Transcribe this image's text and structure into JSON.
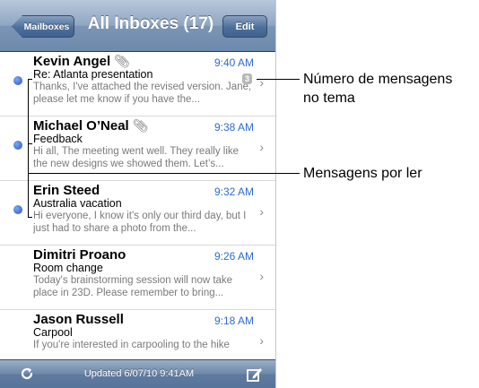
{
  "navbar": {
    "back_label": "Mailboxes",
    "title": "All Inboxes (17)",
    "edit_label": "Edit"
  },
  "messages": [
    {
      "sender": "Kevin Angel",
      "attachment": true,
      "time": "9:40 AM",
      "subject": "Re: Atlanta presentation",
      "preview": "Thanks, I've attached the revised version. Jane, please let me know if you have the...",
      "count": "3",
      "unread": true
    },
    {
      "sender": "Michael O’Neal",
      "attachment": true,
      "time": "9:38 AM",
      "subject": "Feedback",
      "preview": "Hi all, The meeting went well. They really like the new designs we showed them. Let’s...",
      "unread": true
    },
    {
      "sender": "Erin Steed",
      "attachment": false,
      "time": "9:32 AM",
      "subject": "Australia vacation",
      "preview": "Hi everyone, I know it’s only our third day, but I just had to share a photo from the...",
      "unread": true
    },
    {
      "sender": "Dimitri Proano",
      "attachment": false,
      "time": "9:26 AM",
      "subject": "Room change",
      "preview": "Today's brainstorming session will now take place in 23D. Please remember to bring...",
      "unread": false
    },
    {
      "sender": "Jason Russell",
      "attachment": false,
      "time": "9:18 AM",
      "subject": "Carpool",
      "preview": "If you're interested in carpooling to the hike",
      "unread": false
    }
  ],
  "toolbar": {
    "updated_text": "Updated 6/07/10 9:41AM",
    "refresh_icon": "refresh-icon",
    "compose_icon": "compose-icon"
  },
  "callouts": {
    "thread_count_line1": "Número de mensagens",
    "thread_count_line2": "no tema",
    "unread_label": "Mensagens por ler"
  },
  "colors": {
    "unread_dot": "#2454c8",
    "time_text": "#2d6bd6"
  }
}
